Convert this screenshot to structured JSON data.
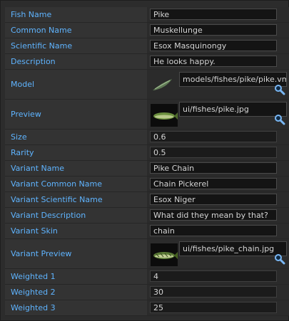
{
  "properties": {
    "fish_name": {
      "label": "Fish Name",
      "value": "Pike"
    },
    "common_name": {
      "label": "Common Name",
      "value": "Muskellunge"
    },
    "scientific_name": {
      "label": "Scientific Name",
      "value": "Esox Masquinongy"
    },
    "description": {
      "label": "Description",
      "value": "He looks happy."
    },
    "model": {
      "label": "Model",
      "value": "models/fishes/pike/pike.vmdl"
    },
    "preview": {
      "label": "Preview",
      "value": "ui/fishes/pike.jpg"
    },
    "size": {
      "label": "Size",
      "value": "0.6"
    },
    "rarity": {
      "label": "Rarity",
      "value": "0.5"
    },
    "variant_name": {
      "label": "Variant Name",
      "value": "Pike Chain"
    },
    "variant_common_name": {
      "label": "Variant Common Name",
      "value": "Chain Pickerel"
    },
    "variant_scientific_name": {
      "label": "Variant Scientific Name",
      "value": "Esox Niger"
    },
    "variant_description": {
      "label": "Variant Description",
      "value": "What did they mean by that?"
    },
    "variant_skin": {
      "label": "Variant Skin",
      "value": "chain"
    },
    "variant_preview": {
      "label": "Variant Preview",
      "value": "ui/fishes/pike_chain.jpg"
    },
    "weighted_1": {
      "label": "Weighted 1",
      "value": "4"
    },
    "weighted_2": {
      "label": "Weighted 2",
      "value": "30"
    },
    "weighted_3": {
      "label": "Weighted 3",
      "value": "25"
    }
  },
  "icons": {
    "asset_browse": "magnifier-icon",
    "model_thumbnail": "fish-model-icon",
    "preview_thumbnail": "fish-preview-image"
  },
  "colors": {
    "label_text": "#5fb4ff",
    "value_text": "#d4d4d4",
    "field_background": "#141414",
    "panel_background": "#2c2c2c"
  }
}
